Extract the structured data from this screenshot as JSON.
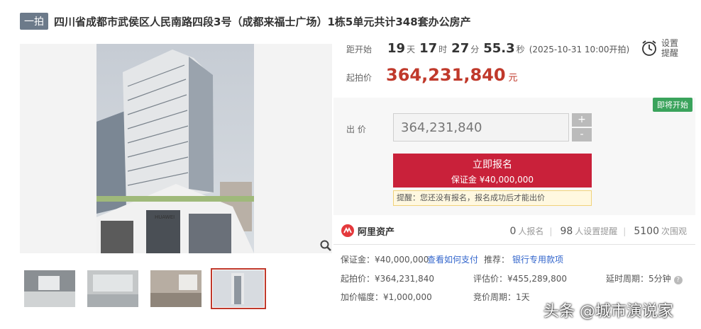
{
  "header": {
    "tag": "一拍",
    "title": "四川省成都市武侯区人民南路四段3号（成都来福士广场）1栋5单元共计348套办公房产"
  },
  "countdown": {
    "label": "距开始",
    "days": "19",
    "days_unit": "天",
    "hours": "17",
    "hours_unit": "时",
    "minutes": "27",
    "minutes_unit": "分",
    "seconds": "55.3",
    "seconds_unit": "秒",
    "start_time": "(2025-10-31 10:00开拍)"
  },
  "reminder": {
    "line1": "设置",
    "line2": "提醒",
    "icon": "alarm-clock-icon"
  },
  "starting_price": {
    "label": "起拍价",
    "value": "364,231,840",
    "unit": "元"
  },
  "bid": {
    "badge": "即将开始",
    "label": "出 价",
    "input_value": "364,231,840",
    "plus": "+",
    "minus": "-",
    "register_label": "立即报名",
    "deposit_label": "保证金 ¥40,000,000",
    "notice": "提醒：您还没有报名，报名成功后才能出价"
  },
  "stats": {
    "brand": "阿里资产",
    "registered_count": "0",
    "registered_label": "人报名",
    "reminders_count": "98",
    "reminders_label": "人设置提醒",
    "views_count": "5100",
    "views_label": "次围观"
  },
  "details": {
    "deposit": "保证金：¥40,000,000",
    "pay_link": "查看如何支付",
    "recommend_label": "推荐：",
    "bank_link": "银行专用款项",
    "start_price": "起拍价：¥364,231,840",
    "appraisal": "评估价：¥455,289,800",
    "delay": "延时周期：5分钟",
    "increment": "加价幅度：¥1,000,000",
    "cycle": "竞价周期：1天"
  },
  "watermark": "头条 @城市演说家",
  "colors": {
    "accent_red": "#c9213a",
    "price_red": "#c0392b",
    "badge_green": "#3aa35c",
    "link_blue": "#3366cc"
  }
}
